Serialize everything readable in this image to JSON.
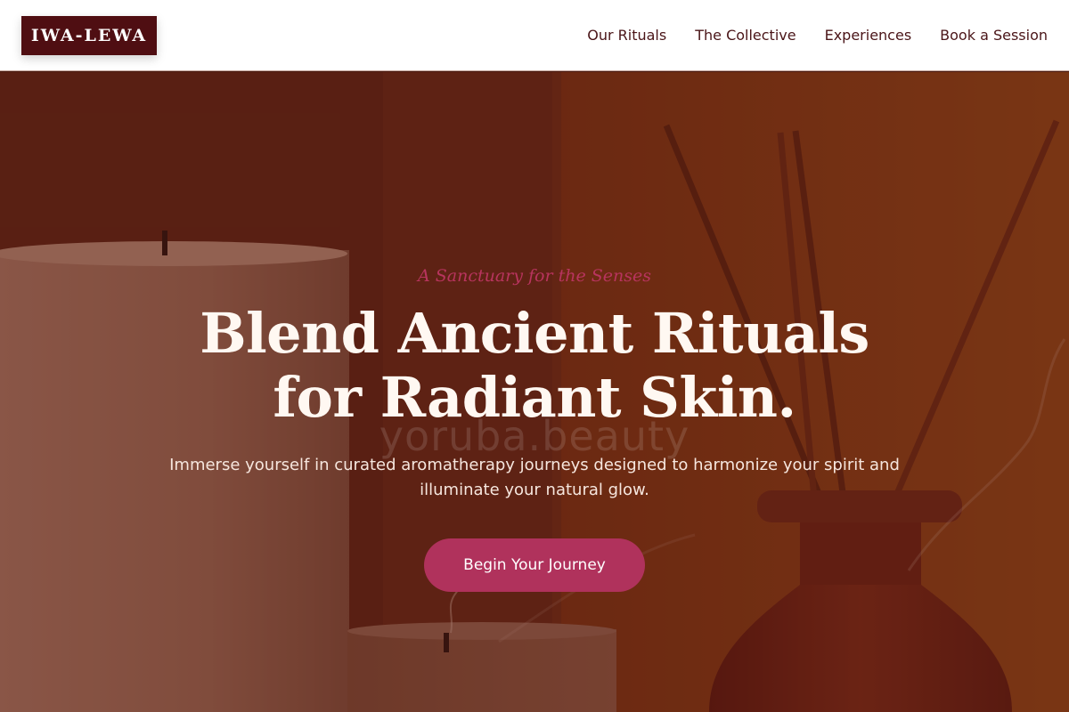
{
  "brand": {
    "logo_text": "IWA-LEWA"
  },
  "nav": {
    "items": [
      {
        "label": "Our Rituals"
      },
      {
        "label": "The Collective"
      },
      {
        "label": "Experiences"
      },
      {
        "label": "Book a Session"
      }
    ]
  },
  "hero": {
    "tagline": "A Sanctuary for the Senses",
    "headline_line1": "Blend Ancient Rituals",
    "headline_line2": "for Radiant Skin.",
    "watermark": "yoruba.beauty",
    "subtext": "Immerse yourself in curated aromatherapy journeys designed to harmonize your spirit and illuminate your natural glow.",
    "cta_label": "Begin Your Journey"
  },
  "colors": {
    "logo_bg": "#4f0e12",
    "nav_text": "#4a1518",
    "accent": "#b0325c",
    "tagline": "#b8345e",
    "hero_overlay": "#5a2414"
  }
}
